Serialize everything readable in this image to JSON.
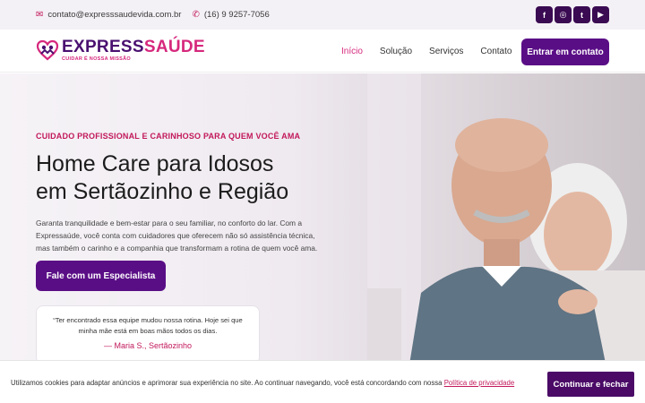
{
  "topbar": {
    "email": "contato@expresssaudevida.com.br",
    "phone": "(16) 9 9257-7056",
    "socials": [
      {
        "icon": "facebook-icon",
        "glyph": "f"
      },
      {
        "icon": "instagram-icon",
        "glyph": "◎"
      },
      {
        "icon": "twitter-icon",
        "glyph": "t"
      },
      {
        "icon": "youtube-icon",
        "glyph": "▶"
      }
    ]
  },
  "header": {
    "logo_part1": "EXPRESS",
    "logo_part2": "SAÚDE",
    "logo_tagline": "CUIDAR É NOSSA MISSÃO",
    "nav": [
      "Início",
      "Solução",
      "Serviços",
      "Contato"
    ],
    "cta": "Entrar em contato"
  },
  "hero": {
    "kicker": "CUIDADO PROFISSIONAL E CARINHOSO PARA QUEM VOCÊ AMA",
    "title_line1": "Home Care para Idosos",
    "title_line2": "em Sertãozinho e Região",
    "lead": "Garanta tranquilidade e bem-estar para o seu familiar, no conforto do lar. Com a Expressaúde, você conta com cuidadores que oferecem não só assistência técnica, mas também o carinho e a companhia que transformam a rotina de quem você ama.",
    "cta": "Fale com um Especialista",
    "testimonial_quote": "“Ter encontrado essa equipe mudou nossa rotina. Hoje sei que minha mãe está em boas mãos todos os dias.",
    "testimonial_author": "— Maria S., Sertãozinho"
  },
  "cookie": {
    "text": "Utilizamos cookies para adaptar anúncios e aprimorar sua experiência no site. Ao continuar navegando, você está concordando com nossa",
    "link": "Política de privacidade",
    "button": "Continuar e fechar"
  },
  "colors": {
    "brand_purple": "#5a0e86",
    "brand_pink": "#d6287d"
  }
}
